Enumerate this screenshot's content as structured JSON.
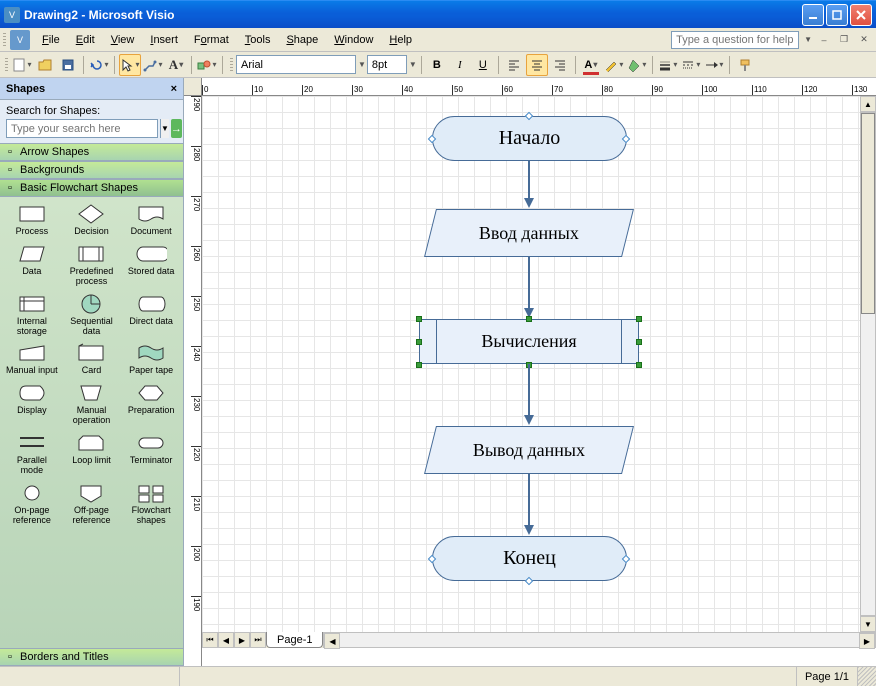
{
  "window": {
    "title": "Drawing2 - Microsoft Visio"
  },
  "menus": {
    "file": "File",
    "edit": "Edit",
    "view": "View",
    "insert": "Insert",
    "format": "Format",
    "tools": "Tools",
    "shape": "Shape",
    "window": "Window",
    "help": "Help"
  },
  "help_placeholder": "Type a question for help",
  "font": {
    "family": "Arial",
    "size": "8pt"
  },
  "sidebar": {
    "title": "Shapes",
    "search_label": "Search for Shapes:",
    "search_placeholder": "Type your search here",
    "stencils": {
      "arrow": "Arrow Shapes",
      "backgrounds": "Backgrounds",
      "basic": "Basic Flowchart Shapes",
      "borders": "Borders and Titles"
    },
    "shapes": [
      "Process",
      "Decision",
      "Document",
      "Data",
      "Predefined process",
      "Stored data",
      "Internal storage",
      "Sequential data",
      "Direct data",
      "Manual input",
      "Card",
      "Paper tape",
      "Display",
      "Manual operation",
      "Preparation",
      "Parallel mode",
      "Loop limit",
      "Terminator",
      "On-page reference",
      "Off-page reference",
      "Flowchart shapes"
    ]
  },
  "flow": {
    "start": "Начало",
    "input": "Ввод данных",
    "process": "Вычисления",
    "output": "Вывод данных",
    "end": "Конец"
  },
  "ruler_h": [
    0,
    10,
    20,
    30,
    40,
    50,
    60,
    70,
    80,
    90,
    100,
    110,
    120,
    130
  ],
  "ruler_v": [
    290,
    280,
    270,
    260,
    250,
    240,
    230,
    220,
    210,
    200,
    190
  ],
  "page_tab": "Page-1",
  "status_page": "Page 1/1"
}
